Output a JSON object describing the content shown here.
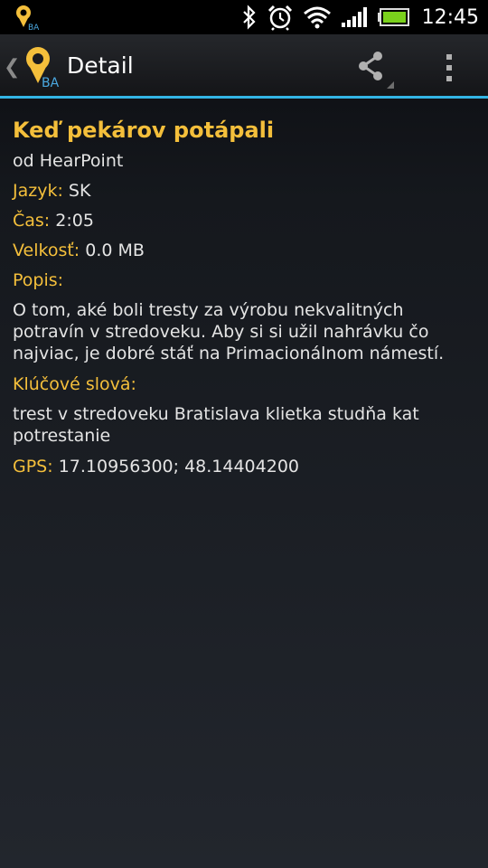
{
  "status_bar": {
    "time": "12:45",
    "icons": [
      "app-notification-icon",
      "bluetooth-icon",
      "alarm-icon",
      "wifi-icon",
      "signal-icon",
      "battery-icon"
    ]
  },
  "action_bar": {
    "up_chevron": "❮",
    "title": "Detail",
    "icons": [
      "app-logo-icon",
      "share-icon",
      "overflow-menu-icon"
    ]
  },
  "detail": {
    "title": "Keď pekárov potápali",
    "author": "od HearPoint",
    "language_label": "Jazyk:",
    "language_value": "SK",
    "time_label": "Čas:",
    "time_value": "2:05",
    "size_label": "Velkosť:",
    "size_value": "0.0 MB",
    "description_label": "Popis:",
    "description_value": "O tom, aké boli tresty za výrobu nekvalitných potravín v stredoveku. Aby si si užil nahrávku čo najviac, je dobré stáť na Primacionálnom námestí.",
    "keywords_label": "Klúčové slová:",
    "keywords_value": "trest v stredoveku Bratislava klietka studňa kat potrestanie",
    "gps_label": "GPS:",
    "gps_value": "17.10956300; 48.14404200"
  },
  "colors": {
    "accent": "#f4bf3b",
    "divider": "#33b5e5",
    "text": "#e4e4e4"
  }
}
